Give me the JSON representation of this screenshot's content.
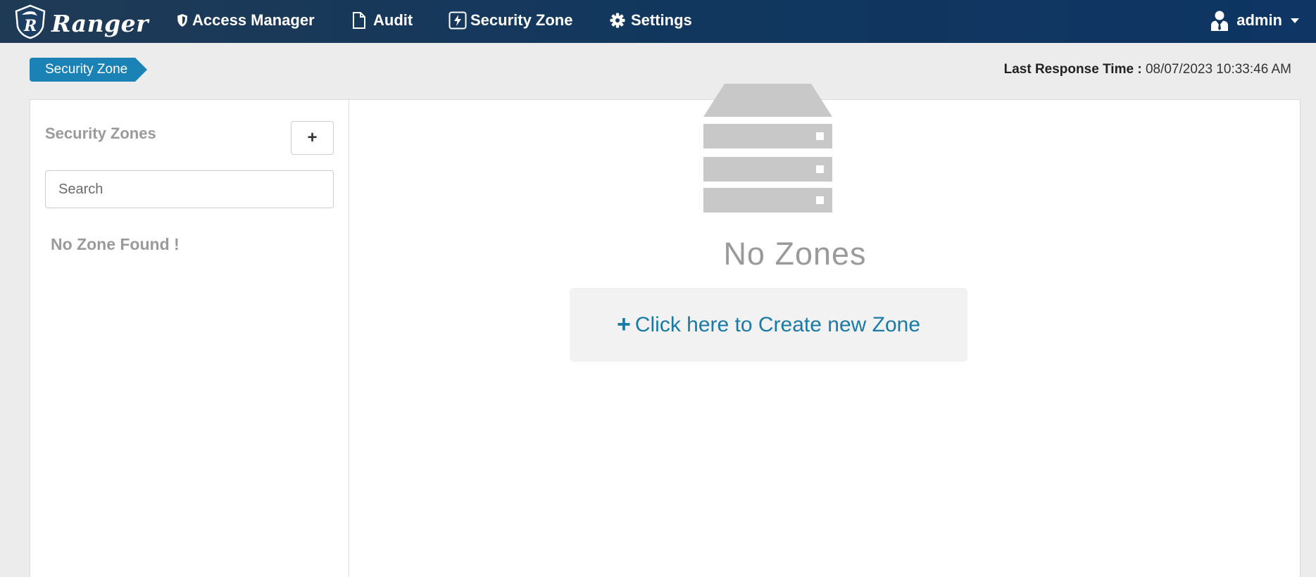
{
  "navbar": {
    "brand": "Ranger",
    "items": [
      {
        "label": "Access Manager",
        "icon": "shield-icon"
      },
      {
        "label": "Audit",
        "icon": "file-icon"
      },
      {
        "label": "Security Zone",
        "icon": "bolt-icon"
      },
      {
        "label": "Settings",
        "icon": "gear-icon"
      }
    ],
    "user": {
      "label": "admin",
      "icon": "user-icon"
    }
  },
  "breadcrumb": {
    "label": "Security Zone"
  },
  "last_response": {
    "label": "Last Response Time :",
    "value": "08/07/2023 10:33:46 AM"
  },
  "sidebar": {
    "title": "Security Zones",
    "add_button": "+",
    "search_placeholder": "Search",
    "empty_text": "No Zone Found !"
  },
  "main": {
    "empty_title": "No Zones",
    "create_link": "Click here to Create new Zone",
    "create_icon": "+"
  },
  "colors": {
    "navbar": "#11375f",
    "accent": "#1a82b5",
    "link": "#1a7aa6",
    "muted": "#9a9a9a"
  }
}
